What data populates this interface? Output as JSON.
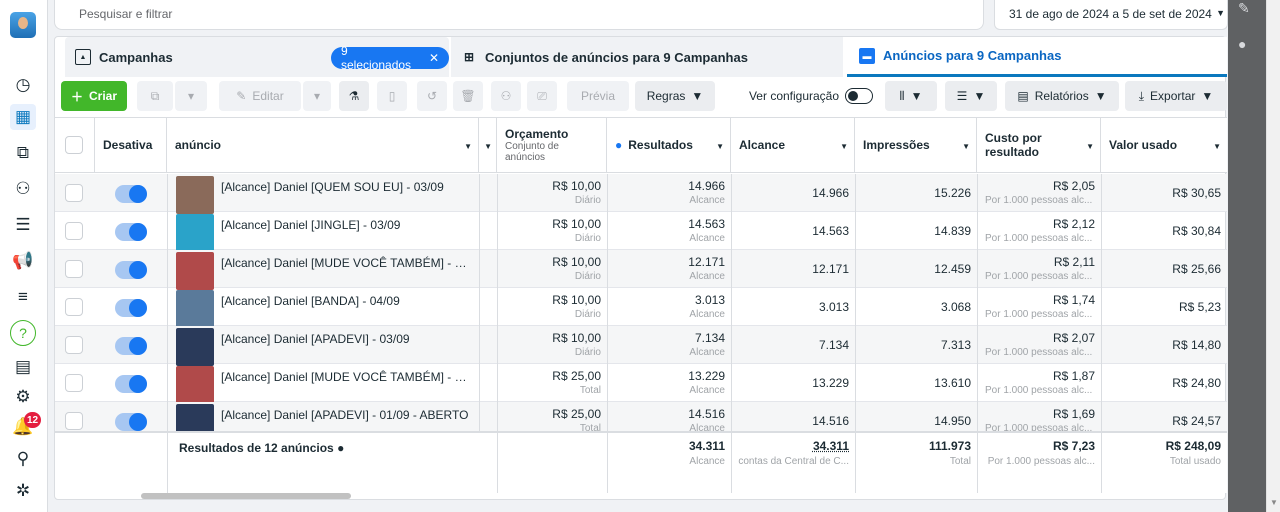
{
  "search": {
    "placeholder": "Pesquisar e filtrar"
  },
  "date_range": "31 de ago de 2024 a 5 de set de 2024",
  "notification_count": "12",
  "tabs": {
    "campaigns": "Campanhas",
    "selected_pill": "9 selecionados",
    "adsets": "Conjuntos de anúncios para 9 Campanhas",
    "ads": "Anúncios para 9 Campanhas"
  },
  "toolbar": {
    "create": "Criar",
    "edit": "Editar",
    "preview": "Prévia",
    "rules": "Regras",
    "view_config": "Ver configuração",
    "reports": "Relatórios",
    "export": "Exportar"
  },
  "columns": {
    "toggle": "Desativa",
    "name": "anúncio",
    "budget": "Orçamento",
    "budget_sub": "Conjunto de anúncios",
    "results": "Resultados",
    "reach": "Alcance",
    "impressions": "Impressões",
    "cost": "Custo por resultado",
    "spent": "Valor usado"
  },
  "rows": [
    {
      "name": "[Alcance] Daniel [QUEM SOU EU] - 03/09",
      "budget": "R$ 10,00",
      "budget_type": "Diário",
      "results": "14.966",
      "results_type": "Alcance",
      "reach": "14.966",
      "impressions": "15.226",
      "cost": "R$ 2,05",
      "cost_sub": "Por 1.000 pessoas alc...",
      "spent": "R$ 30,65",
      "thumb_color": "#8a6a5a"
    },
    {
      "name": "[Alcance] Daniel [JINGLE] - 03/09",
      "budget": "R$ 10,00",
      "budget_type": "Diário",
      "results": "14.563",
      "results_type": "Alcance",
      "reach": "14.563",
      "impressions": "14.839",
      "cost": "R$ 2,12",
      "cost_sub": "Por 1.000 pessoas alc...",
      "spent": "R$ 30,84",
      "thumb_color": "#2aa3c9"
    },
    {
      "name": "[Alcance] Daniel [MUDE VOCÊ TAMBÉM] - 0...",
      "budget": "R$ 10,00",
      "budget_type": "Diário",
      "results": "12.171",
      "results_type": "Alcance",
      "reach": "12.171",
      "impressions": "12.459",
      "cost": "R$ 2,11",
      "cost_sub": "Por 1.000 pessoas alc...",
      "spent": "R$ 25,66",
      "thumb_color": "#b04a4a"
    },
    {
      "name": "[Alcance] Daniel [BANDA] - 04/09",
      "budget": "R$ 10,00",
      "budget_type": "Diário",
      "results": "3.013",
      "results_type": "Alcance",
      "reach": "3.013",
      "impressions": "3.068",
      "cost": "R$ 1,74",
      "cost_sub": "Por 1.000 pessoas alc...",
      "spent": "R$ 5,23",
      "thumb_color": "#5a7a9a"
    },
    {
      "name": "[Alcance] Daniel [APADEVI] - 03/09",
      "budget": "R$ 10,00",
      "budget_type": "Diário",
      "results": "7.134",
      "results_type": "Alcance",
      "reach": "7.134",
      "impressions": "7.313",
      "cost": "R$ 2,07",
      "cost_sub": "Por 1.000 pessoas alc...",
      "spent": "R$ 14,80",
      "thumb_color": "#2a3a5a"
    },
    {
      "name": "[Alcance] Daniel [MUDE VOCÊ TAMBÉM] - 0...",
      "budget": "R$ 25,00",
      "budget_type": "Total",
      "results": "13.229",
      "results_type": "Alcance",
      "reach": "13.229",
      "impressions": "13.610",
      "cost": "R$ 1,87",
      "cost_sub": "Por 1.000 pessoas alc...",
      "spent": "R$ 24,80",
      "thumb_color": "#b04a4a"
    },
    {
      "name": "[Alcance] Daniel [APADEVI] - 01/09 - ABERTO",
      "budget": "R$ 25,00",
      "budget_type": "Total",
      "results": "14.516",
      "results_type": "Alcance",
      "reach": "14.516",
      "impressions": "14.950",
      "cost": "R$ 1,69",
      "cost_sub": "Por 1.000 pessoas alc...",
      "spent": "R$ 24,57",
      "thumb_color": "#2a3a5a"
    }
  ],
  "footer": {
    "label": "Resultados de 12 anúncios",
    "results": "34.311",
    "results_sub": "Alcance",
    "reach": "34.311",
    "reach_sub": "contas da Central de C...",
    "impressions": "111.973",
    "impressions_sub": "Total",
    "cost": "R$ 7,23",
    "cost_sub": "Por 1.000 pessoas alc...",
    "spent": "R$ 248,09",
    "spent_sub": "Total usado"
  },
  "colors": {
    "accent": "#1877f2",
    "create": "#42b72a",
    "badge": "#e41e3f"
  }
}
